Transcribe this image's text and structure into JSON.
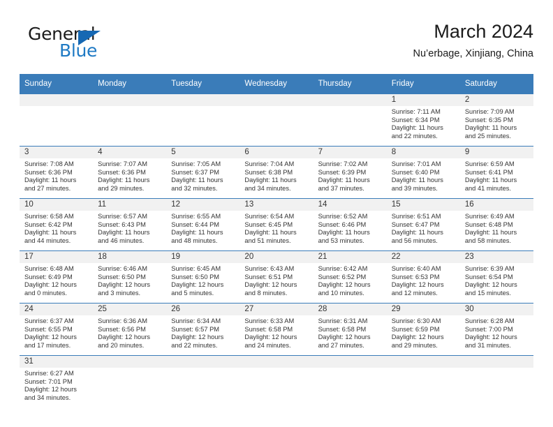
{
  "logo": {
    "text_primary": "General",
    "text_secondary": "Blue",
    "primary_color": "#1b1b1b",
    "secondary_color": "#1f7ac4",
    "triangle_color": "#1668b3"
  },
  "header": {
    "title": "March 2024",
    "subtitle": "Nu’erbage, Xinjiang, China"
  },
  "theme": {
    "header_bg": "#3a7cb9",
    "header_text": "#ffffff",
    "daynum_band_bg": "#f1f1f1",
    "cell_bg": "#ffffff",
    "row_divider": "#3a7cb9",
    "body_text": "#333333"
  },
  "weekday_headers": [
    "Sunday",
    "Monday",
    "Tuesday",
    "Wednesday",
    "Thursday",
    "Friday",
    "Saturday"
  ],
  "labels": {
    "sunrise_prefix": "Sunrise:",
    "sunset_prefix": "Sunset:",
    "daylight_prefix": "Daylight:"
  },
  "weeks": [
    [
      {
        "day": "",
        "empty": true,
        "sunrise": "",
        "sunset": "",
        "daylight_line1": "",
        "daylight_line2": ""
      },
      {
        "day": "",
        "empty": true,
        "sunrise": "",
        "sunset": "",
        "daylight_line1": "",
        "daylight_line2": ""
      },
      {
        "day": "",
        "empty": true,
        "sunrise": "",
        "sunset": "",
        "daylight_line1": "",
        "daylight_line2": ""
      },
      {
        "day": "",
        "empty": true,
        "sunrise": "",
        "sunset": "",
        "daylight_line1": "",
        "daylight_line2": ""
      },
      {
        "day": "",
        "empty": true,
        "sunrise": "",
        "sunset": "",
        "daylight_line1": "",
        "daylight_line2": ""
      },
      {
        "day": "1",
        "empty": false,
        "sunrise": "Sunrise: 7:11 AM",
        "sunset": "Sunset: 6:34 PM",
        "daylight_line1": "Daylight: 11 hours",
        "daylight_line2": "and 22 minutes."
      },
      {
        "day": "2",
        "empty": false,
        "sunrise": "Sunrise: 7:09 AM",
        "sunset": "Sunset: 6:35 PM",
        "daylight_line1": "Daylight: 11 hours",
        "daylight_line2": "and 25 minutes."
      }
    ],
    [
      {
        "day": "3",
        "empty": false,
        "sunrise": "Sunrise: 7:08 AM",
        "sunset": "Sunset: 6:36 PM",
        "daylight_line1": "Daylight: 11 hours",
        "daylight_line2": "and 27 minutes."
      },
      {
        "day": "4",
        "empty": false,
        "sunrise": "Sunrise: 7:07 AM",
        "sunset": "Sunset: 6:36 PM",
        "daylight_line1": "Daylight: 11 hours",
        "daylight_line2": "and 29 minutes."
      },
      {
        "day": "5",
        "empty": false,
        "sunrise": "Sunrise: 7:05 AM",
        "sunset": "Sunset: 6:37 PM",
        "daylight_line1": "Daylight: 11 hours",
        "daylight_line2": "and 32 minutes."
      },
      {
        "day": "6",
        "empty": false,
        "sunrise": "Sunrise: 7:04 AM",
        "sunset": "Sunset: 6:38 PM",
        "daylight_line1": "Daylight: 11 hours",
        "daylight_line2": "and 34 minutes."
      },
      {
        "day": "7",
        "empty": false,
        "sunrise": "Sunrise: 7:02 AM",
        "sunset": "Sunset: 6:39 PM",
        "daylight_line1": "Daylight: 11 hours",
        "daylight_line2": "and 37 minutes."
      },
      {
        "day": "8",
        "empty": false,
        "sunrise": "Sunrise: 7:01 AM",
        "sunset": "Sunset: 6:40 PM",
        "daylight_line1": "Daylight: 11 hours",
        "daylight_line2": "and 39 minutes."
      },
      {
        "day": "9",
        "empty": false,
        "sunrise": "Sunrise: 6:59 AM",
        "sunset": "Sunset: 6:41 PM",
        "daylight_line1": "Daylight: 11 hours",
        "daylight_line2": "and 41 minutes."
      }
    ],
    [
      {
        "day": "10",
        "empty": false,
        "sunrise": "Sunrise: 6:58 AM",
        "sunset": "Sunset: 6:42 PM",
        "daylight_line1": "Daylight: 11 hours",
        "daylight_line2": "and 44 minutes."
      },
      {
        "day": "11",
        "empty": false,
        "sunrise": "Sunrise: 6:57 AM",
        "sunset": "Sunset: 6:43 PM",
        "daylight_line1": "Daylight: 11 hours",
        "daylight_line2": "and 46 minutes."
      },
      {
        "day": "12",
        "empty": false,
        "sunrise": "Sunrise: 6:55 AM",
        "sunset": "Sunset: 6:44 PM",
        "daylight_line1": "Daylight: 11 hours",
        "daylight_line2": "and 48 minutes."
      },
      {
        "day": "13",
        "empty": false,
        "sunrise": "Sunrise: 6:54 AM",
        "sunset": "Sunset: 6:45 PM",
        "daylight_line1": "Daylight: 11 hours",
        "daylight_line2": "and 51 minutes."
      },
      {
        "day": "14",
        "empty": false,
        "sunrise": "Sunrise: 6:52 AM",
        "sunset": "Sunset: 6:46 PM",
        "daylight_line1": "Daylight: 11 hours",
        "daylight_line2": "and 53 minutes."
      },
      {
        "day": "15",
        "empty": false,
        "sunrise": "Sunrise: 6:51 AM",
        "sunset": "Sunset: 6:47 PM",
        "daylight_line1": "Daylight: 11 hours",
        "daylight_line2": "and 56 minutes."
      },
      {
        "day": "16",
        "empty": false,
        "sunrise": "Sunrise: 6:49 AM",
        "sunset": "Sunset: 6:48 PM",
        "daylight_line1": "Daylight: 11 hours",
        "daylight_line2": "and 58 minutes."
      }
    ],
    [
      {
        "day": "17",
        "empty": false,
        "sunrise": "Sunrise: 6:48 AM",
        "sunset": "Sunset: 6:49 PM",
        "daylight_line1": "Daylight: 12 hours",
        "daylight_line2": "and 0 minutes."
      },
      {
        "day": "18",
        "empty": false,
        "sunrise": "Sunrise: 6:46 AM",
        "sunset": "Sunset: 6:50 PM",
        "daylight_line1": "Daylight: 12 hours",
        "daylight_line2": "and 3 minutes."
      },
      {
        "day": "19",
        "empty": false,
        "sunrise": "Sunrise: 6:45 AM",
        "sunset": "Sunset: 6:50 PM",
        "daylight_line1": "Daylight: 12 hours",
        "daylight_line2": "and 5 minutes."
      },
      {
        "day": "20",
        "empty": false,
        "sunrise": "Sunrise: 6:43 AM",
        "sunset": "Sunset: 6:51 PM",
        "daylight_line1": "Daylight: 12 hours",
        "daylight_line2": "and 8 minutes."
      },
      {
        "day": "21",
        "empty": false,
        "sunrise": "Sunrise: 6:42 AM",
        "sunset": "Sunset: 6:52 PM",
        "daylight_line1": "Daylight: 12 hours",
        "daylight_line2": "and 10 minutes."
      },
      {
        "day": "22",
        "empty": false,
        "sunrise": "Sunrise: 6:40 AM",
        "sunset": "Sunset: 6:53 PM",
        "daylight_line1": "Daylight: 12 hours",
        "daylight_line2": "and 12 minutes."
      },
      {
        "day": "23",
        "empty": false,
        "sunrise": "Sunrise: 6:39 AM",
        "sunset": "Sunset: 6:54 PM",
        "daylight_line1": "Daylight: 12 hours",
        "daylight_line2": "and 15 minutes."
      }
    ],
    [
      {
        "day": "24",
        "empty": false,
        "sunrise": "Sunrise: 6:37 AM",
        "sunset": "Sunset: 6:55 PM",
        "daylight_line1": "Daylight: 12 hours",
        "daylight_line2": "and 17 minutes."
      },
      {
        "day": "25",
        "empty": false,
        "sunrise": "Sunrise: 6:36 AM",
        "sunset": "Sunset: 6:56 PM",
        "daylight_line1": "Daylight: 12 hours",
        "daylight_line2": "and 20 minutes."
      },
      {
        "day": "26",
        "empty": false,
        "sunrise": "Sunrise: 6:34 AM",
        "sunset": "Sunset: 6:57 PM",
        "daylight_line1": "Daylight: 12 hours",
        "daylight_line2": "and 22 minutes."
      },
      {
        "day": "27",
        "empty": false,
        "sunrise": "Sunrise: 6:33 AM",
        "sunset": "Sunset: 6:58 PM",
        "daylight_line1": "Daylight: 12 hours",
        "daylight_line2": "and 24 minutes."
      },
      {
        "day": "28",
        "empty": false,
        "sunrise": "Sunrise: 6:31 AM",
        "sunset": "Sunset: 6:58 PM",
        "daylight_line1": "Daylight: 12 hours",
        "daylight_line2": "and 27 minutes."
      },
      {
        "day": "29",
        "empty": false,
        "sunrise": "Sunrise: 6:30 AM",
        "sunset": "Sunset: 6:59 PM",
        "daylight_line1": "Daylight: 12 hours",
        "daylight_line2": "and 29 minutes."
      },
      {
        "day": "30",
        "empty": false,
        "sunrise": "Sunrise: 6:28 AM",
        "sunset": "Sunset: 7:00 PM",
        "daylight_line1": "Daylight: 12 hours",
        "daylight_line2": "and 31 minutes."
      }
    ],
    [
      {
        "day": "31",
        "empty": false,
        "sunrise": "Sunrise: 6:27 AM",
        "sunset": "Sunset: 7:01 PM",
        "daylight_line1": "Daylight: 12 hours",
        "daylight_line2": "and 34 minutes."
      },
      {
        "day": "",
        "empty": true,
        "sunrise": "",
        "sunset": "",
        "daylight_line1": "",
        "daylight_line2": ""
      },
      {
        "day": "",
        "empty": true,
        "sunrise": "",
        "sunset": "",
        "daylight_line1": "",
        "daylight_line2": ""
      },
      {
        "day": "",
        "empty": true,
        "sunrise": "",
        "sunset": "",
        "daylight_line1": "",
        "daylight_line2": ""
      },
      {
        "day": "",
        "empty": true,
        "sunrise": "",
        "sunset": "",
        "daylight_line1": "",
        "daylight_line2": ""
      },
      {
        "day": "",
        "empty": true,
        "sunrise": "",
        "sunset": "",
        "daylight_line1": "",
        "daylight_line2": ""
      },
      {
        "day": "",
        "empty": true,
        "sunrise": "",
        "sunset": "",
        "daylight_line1": "",
        "daylight_line2": ""
      }
    ]
  ]
}
